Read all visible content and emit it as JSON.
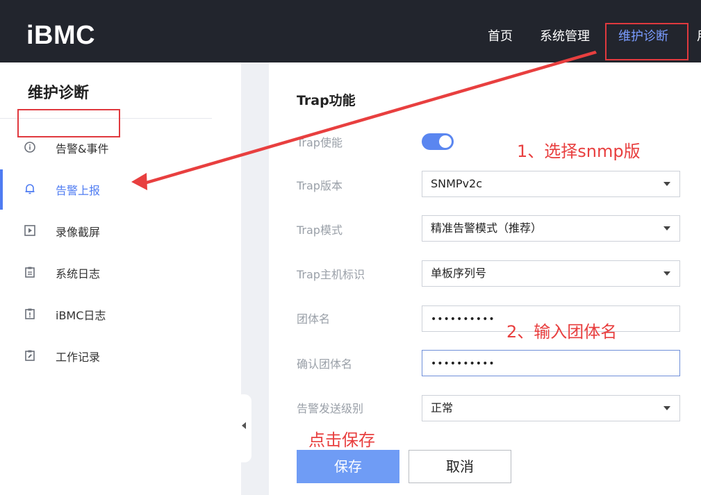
{
  "header": {
    "logo": "iBMC",
    "nav": [
      {
        "label": "首页",
        "active": false
      },
      {
        "label": "系统管理",
        "active": false
      },
      {
        "label": "维护诊断",
        "active": true
      },
      {
        "label": "用",
        "active": false
      }
    ]
  },
  "sidebar": {
    "title": "维护诊断",
    "items": [
      {
        "label": "告警&事件",
        "icon": "info-circle-icon",
        "active": false
      },
      {
        "label": "告警上报",
        "icon": "bell-icon",
        "active": true
      },
      {
        "label": "录像截屏",
        "icon": "play-box-icon",
        "active": false
      },
      {
        "label": "系统日志",
        "icon": "clipboard-icon",
        "active": false
      },
      {
        "label": "iBMC日志",
        "icon": "clipboard-alert-icon",
        "active": false
      },
      {
        "label": "工作记录",
        "icon": "clipboard-edit-icon",
        "active": false
      }
    ]
  },
  "main": {
    "section_title": "Trap功能",
    "fields": {
      "enable_label": "Trap使能",
      "enable_on": true,
      "version_label": "Trap版本",
      "version_value": "SNMPv2c",
      "mode_label": "Trap模式",
      "mode_value": "精准告警模式（推荐）",
      "host_id_label": "Trap主机标识",
      "host_id_value": "单板序列号",
      "community_label": "团体名",
      "community_value": "••••••••••",
      "confirm_label": "确认团体名",
      "confirm_value": "••••••••••",
      "level_label": "告警发送级别",
      "level_value": "正常"
    },
    "save_label": "保存",
    "cancel_label": "取消"
  },
  "annotations": {
    "step1": "1、选择snmp版",
    "step2": "2、输入团体名",
    "step3": "点击保存",
    "color": "#e83f3f"
  },
  "colors": {
    "accent": "#4f7cf2",
    "header_bg": "#22252d",
    "save_button": "#6f9cf5"
  }
}
